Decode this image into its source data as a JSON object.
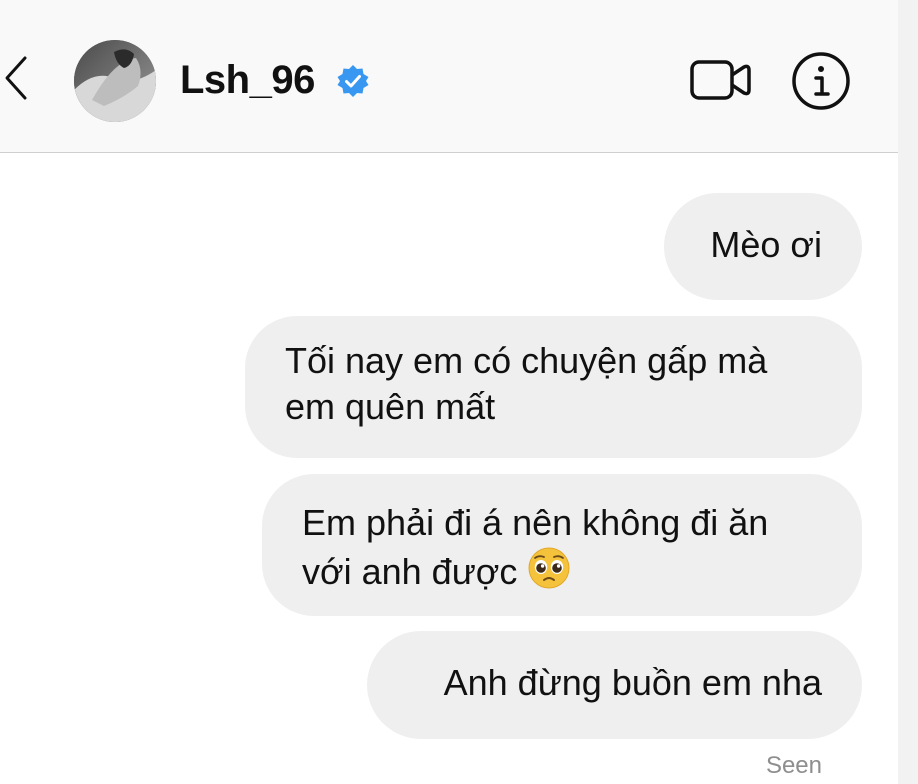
{
  "header": {
    "back_icon": "chevron-left-icon",
    "username": "Lsh_96",
    "verified_icon": "verified-badge-icon",
    "video_icon": "video-camera-icon",
    "info_icon": "info-icon"
  },
  "messages": [
    {
      "lines": [
        "Mèo ơi"
      ],
      "sender": "me"
    },
    {
      "lines": [
        "Tối nay em có chuyện gấp mà",
        "em quên mất"
      ],
      "sender": "me"
    },
    {
      "lines": [
        "Em phải đi á nên không đi ăn",
        "với anh được"
      ],
      "sender": "me",
      "emoji": "pleading-face-emoji"
    },
    {
      "lines": [
        "Anh đừng buồn em nha"
      ],
      "sender": "me"
    }
  ],
  "status": {
    "seen": "Seen"
  },
  "colors": {
    "header_bg": "#f9f9f9",
    "bubble_bg": "#efefef",
    "verified_blue": "#3897f0",
    "text": "#111111",
    "muted": "#8e8e8e"
  }
}
